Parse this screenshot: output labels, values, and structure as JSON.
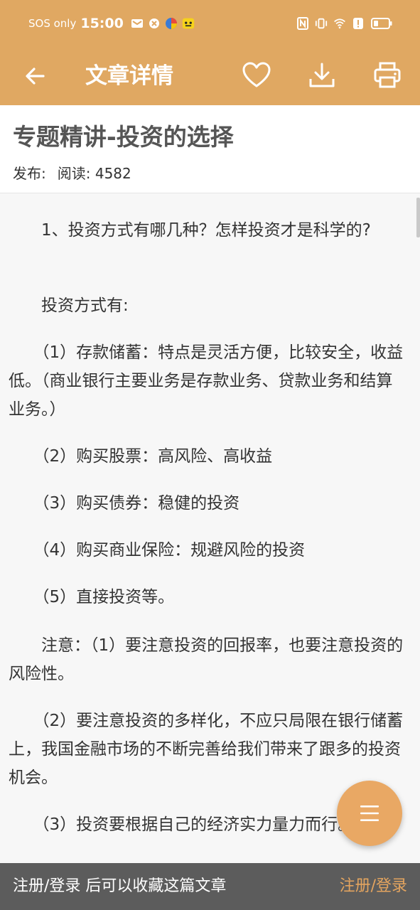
{
  "status_bar": {
    "carrier": "SOS only",
    "time": "15:00",
    "battery_icon": "battery-icon",
    "wifi_icon": "wifi-icon",
    "nfc_icon": "nfc-icon",
    "vibrate_icon": "vibrate-icon"
  },
  "appbar": {
    "title": "文章详情",
    "back_icon": "back-arrow-icon",
    "favorite_icon": "heart-icon",
    "download_icon": "download-icon",
    "print_icon": "printer-icon",
    "color": "#e0a862"
  },
  "article": {
    "title": "专题精讲-投资的选择",
    "publish_label": "发布:",
    "read_label": "阅读: 4582",
    "paragraphs": [
      "　　1、投资方式有哪几种？怎样投资才是科学的?",
      "　　投资方式有:",
      "　　（1）存款储蓄：特点是灵活方便，比较安全，收益低。（商业银行主要业务是存款业务、贷款业务和结算业务。）",
      "　　（2）购买股票：高风险、高收益",
      "　　（3）购买债券：稳健的投资",
      "　　（4）购买商业保险：规避风险的投资",
      "　　（5）直接投资等。",
      "　　注意：（1）要注意投资的回报率，也要注意投资的风险性。",
      "　　（2）要注意投资的多样化，不应只局限在银行储蓄上，我国金融市场的不断完善给我们带来了跟多的投资机会。",
      "　　（3）投资要根据自己的经济实力量力而行。"
    ]
  },
  "fab": {
    "icon": "menu-icon",
    "color": "#e9a864"
  },
  "bottom_bar": {
    "prompt": "注册/登录 后可以收藏这篇文章",
    "login_link": "注册/登录",
    "link_color": "#e3a45f"
  }
}
